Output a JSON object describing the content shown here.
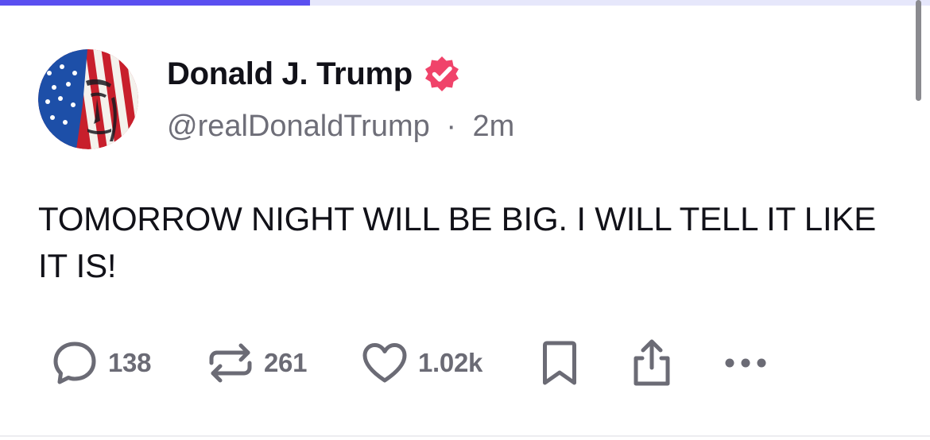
{
  "progress": {
    "fraction": 0.333,
    "fill_color": "#5a4ff0",
    "track_color": "#e6e7fb"
  },
  "post": {
    "display_name": "Donald J. Trump",
    "verified": true,
    "handle": "@realDonaldTrump",
    "separator": "·",
    "timestamp": "2m",
    "text": "TOMORROW NIGHT WILL BE BIG. I WILL TELL IT LIKE IT IS!"
  },
  "actions": {
    "replies": {
      "icon": "reply-icon",
      "count": "138"
    },
    "reposts": {
      "icon": "repost-icon",
      "count": "261"
    },
    "likes": {
      "icon": "heart-icon",
      "count": "1.02k"
    },
    "bookmark": {
      "icon": "bookmark-icon"
    },
    "share": {
      "icon": "share-icon"
    },
    "more": {
      "icon": "more-icon"
    }
  },
  "colors": {
    "verified_badge": "#f0436a",
    "icon_gray": "#6b6b75",
    "text_primary": "#111118",
    "text_secondary": "#6e6e78"
  }
}
